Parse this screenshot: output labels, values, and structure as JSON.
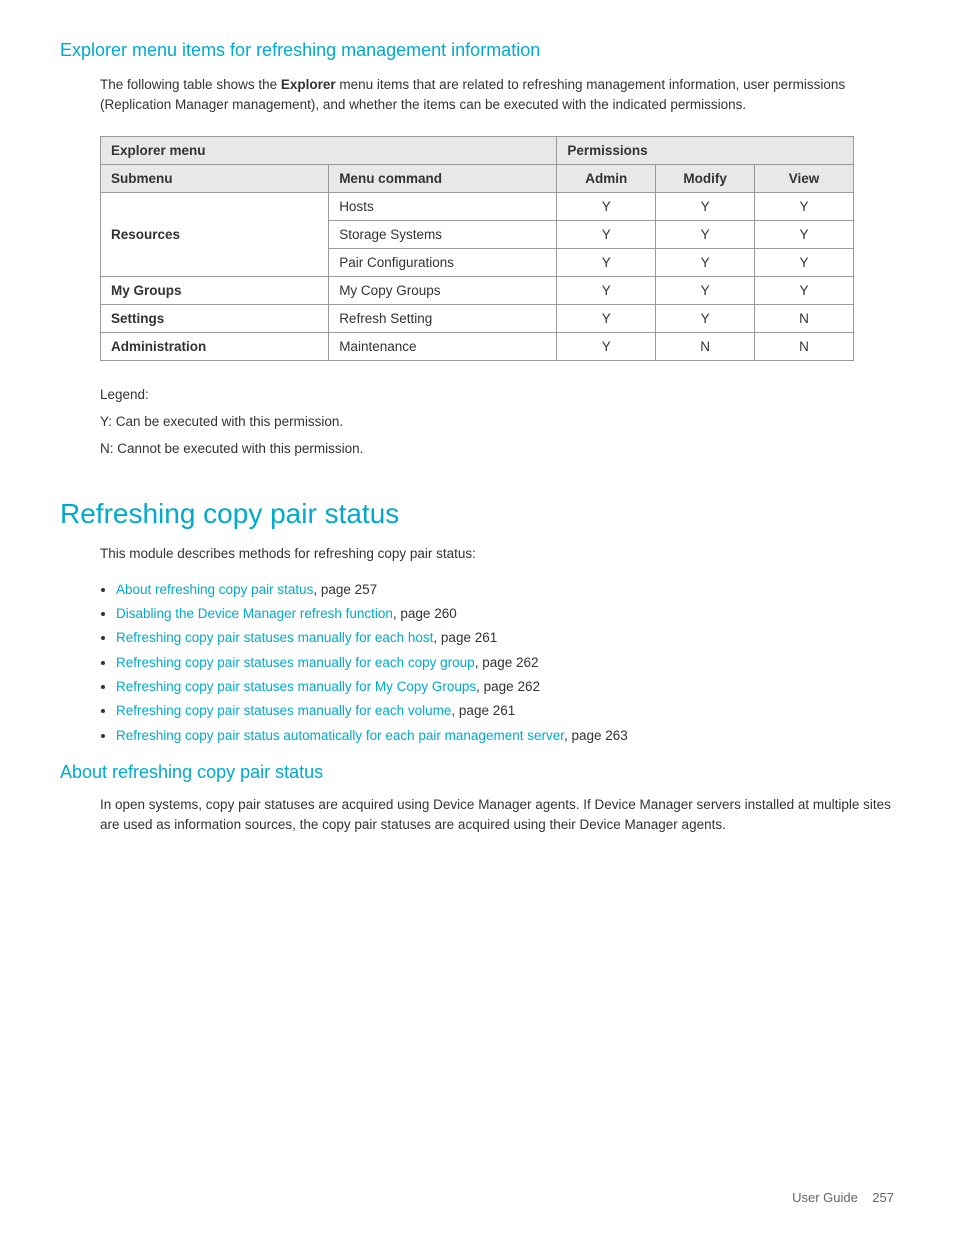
{
  "page": {
    "section1": {
      "heading": "Explorer menu items for refreshing management information",
      "intro": "The following table shows the Explorer menu items that are related to refreshing management information, user permissions (Replication Manager management), and whether the items can be executed with the indicated permissions.",
      "intro_bold": "Explorer",
      "table": {
        "col1_header": "Explorer menu",
        "col2_header": "Permissions",
        "subheaders": [
          "Submenu",
          "Menu command",
          "Admin",
          "Modify",
          "View"
        ],
        "rows": [
          {
            "submenu": "Resources",
            "menu_command": "Hosts",
            "admin": "Y",
            "modify": "Y",
            "view": "Y",
            "rowspan": 3
          },
          {
            "submenu": "",
            "menu_command": "Storage Systems",
            "admin": "Y",
            "modify": "Y",
            "view": "Y"
          },
          {
            "submenu": "",
            "menu_command": "Pair Configurations",
            "admin": "Y",
            "modify": "Y",
            "view": "Y"
          },
          {
            "submenu": "My Groups",
            "menu_command": "My Copy Groups",
            "admin": "Y",
            "modify": "Y",
            "view": "Y",
            "rowspan": 1
          },
          {
            "submenu": "Settings",
            "menu_command": "Refresh Setting",
            "admin": "Y",
            "modify": "Y",
            "view": "N",
            "rowspan": 1
          },
          {
            "submenu": "Administration",
            "menu_command": "Maintenance",
            "admin": "Y",
            "modify": "N",
            "view": "N",
            "rowspan": 1
          }
        ]
      },
      "legend": {
        "title": "Legend:",
        "items": [
          "Y: Can be executed with this permission.",
          "N: Cannot be executed with this permission."
        ]
      }
    },
    "section2": {
      "heading": "Refreshing copy pair status",
      "intro": "This module describes methods for refreshing copy pair status:",
      "bullets": [
        {
          "link_text": "About refreshing copy pair status",
          "page": "257"
        },
        {
          "link_text": "Disabling the Device Manager refresh function",
          "page": "260"
        },
        {
          "link_text": "Refreshing copy pair statuses manually for each host",
          "page": "261"
        },
        {
          "link_text": "Refreshing copy pair statuses manually for each copy group",
          "page": "262"
        },
        {
          "link_text": "Refreshing copy pair statuses manually for My Copy Groups",
          "page": "262"
        },
        {
          "link_text": "Refreshing copy pair statuses manually for each volume",
          "page": "261"
        },
        {
          "link_text": "Refreshing copy pair status automatically for each pair management server",
          "page": "263"
        }
      ]
    },
    "section3": {
      "heading": "About refreshing copy pair status",
      "body": "In open systems, copy pair statuses are acquired using Device Manager agents. If Device Manager servers installed at multiple sites are used as information sources, the copy pair statuses are acquired using their Device Manager agents."
    },
    "footer": {
      "label": "User Guide",
      "page_number": "257"
    }
  }
}
